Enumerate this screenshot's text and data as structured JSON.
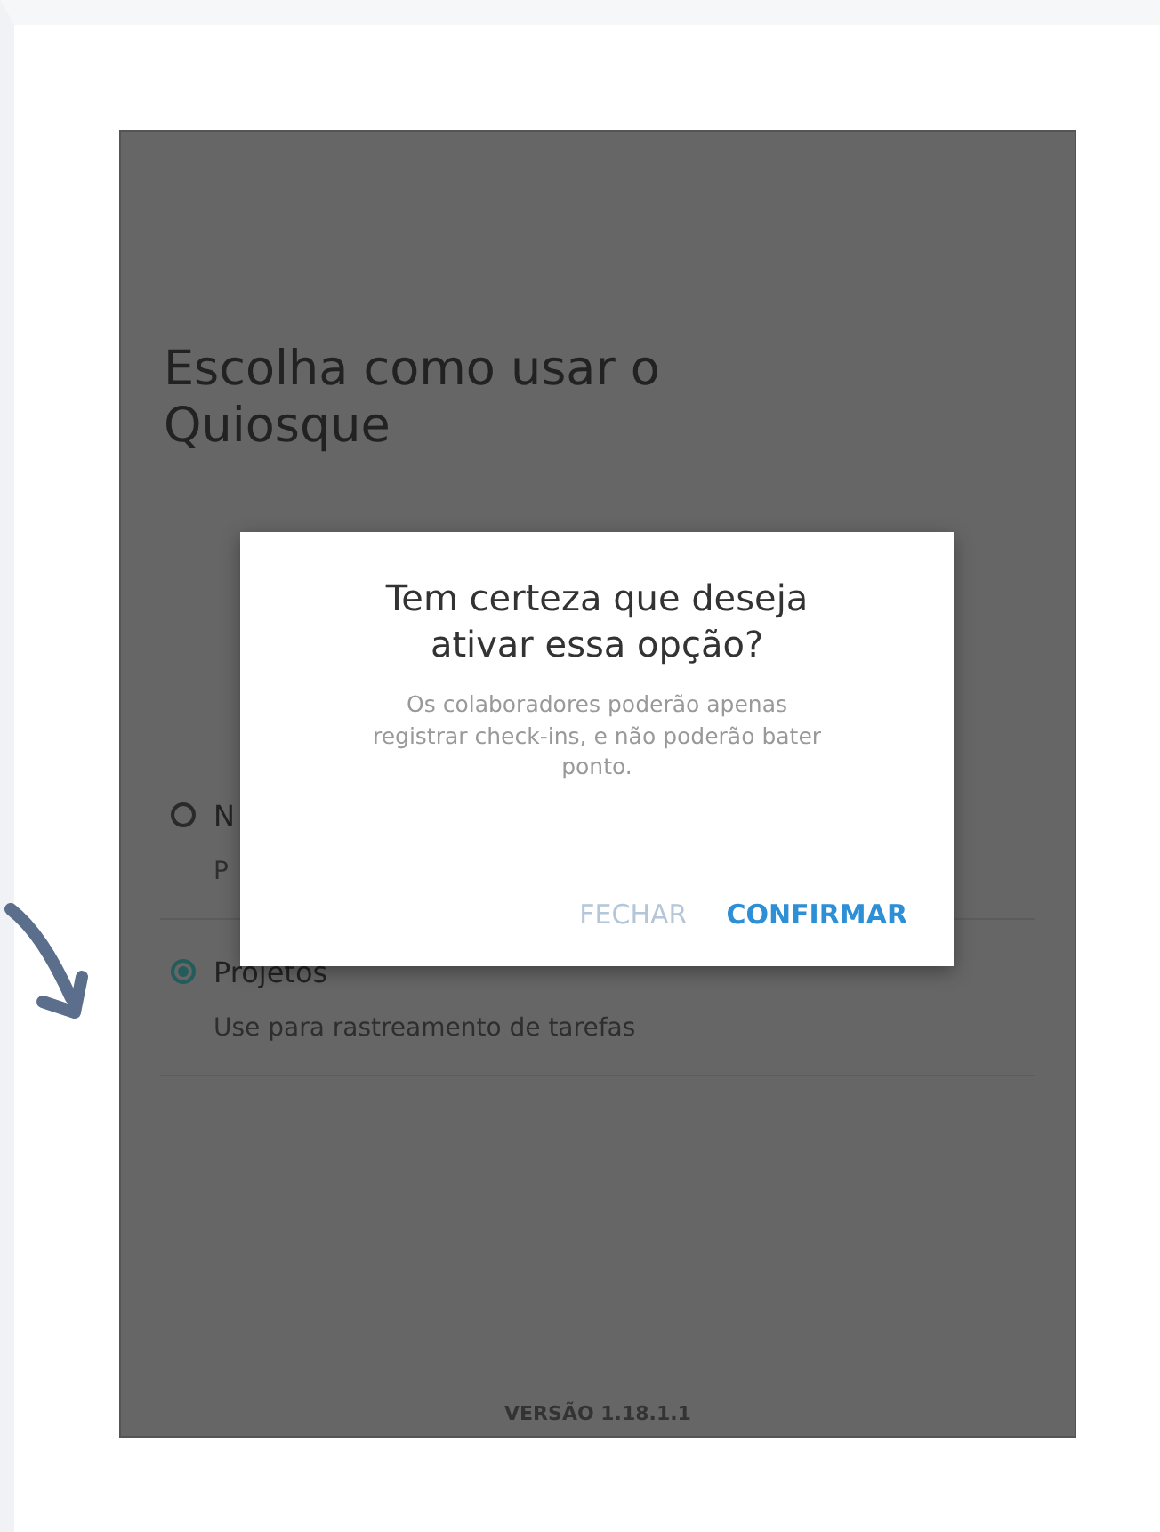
{
  "screen": {
    "title": "Escolha como usar o Quiosque",
    "options": [
      {
        "title": "N",
        "subtitle": "P",
        "selected": false
      },
      {
        "title": "Projetos",
        "subtitle": "Use para rastreamento de tarefas",
        "selected": true
      }
    ],
    "version": "VERSÃO 1.18.1.1"
  },
  "dialog": {
    "title": "Tem certeza que deseja ativar essa opção?",
    "message": "Os colaboradores poderão apenas registrar check-ins, e não poderão bater ponto.",
    "buttons": [
      {
        "label": "FECHAR",
        "kind": "secondary"
      },
      {
        "label": "CONFIRMAR",
        "kind": "primary"
      }
    ]
  }
}
